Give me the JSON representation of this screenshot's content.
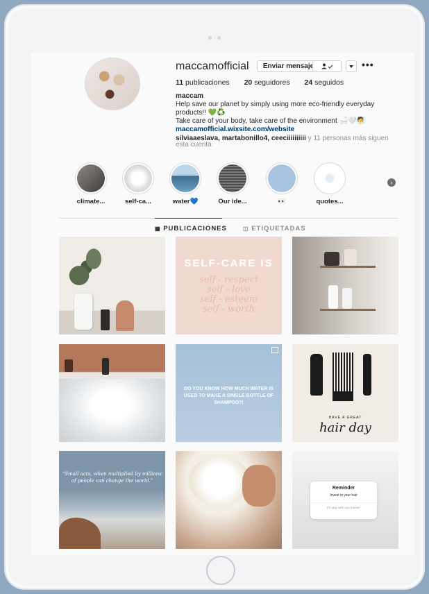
{
  "profile": {
    "username": "maccamofficial",
    "message_button": "Enviar mensaje",
    "follow_icon": "person-check-icon",
    "dropdown_icon": "chevron-down-icon",
    "more_icon": "ellipsis-icon",
    "more_label": "•••"
  },
  "stats": {
    "posts_count": "11",
    "posts_label": "publicaciones",
    "followers_count": "20",
    "followers_label": "seguidores",
    "following_count": "24",
    "following_label": "seguidos"
  },
  "bio": {
    "name": "maccam",
    "line1": "Help save our planet by simply using more eco-friendly everyday products!! 💚♻️",
    "line2": "Take care of your body, take care of the environment 🛁🤍🧖",
    "link": "maccamofficial.wixsite.com/website"
  },
  "followed_by": {
    "names": "silviaaeslava, martabonillo4, ceeciiiiiiiiii",
    "rest": " y 11 personas más siguen esta cuenta"
  },
  "highlights": [
    {
      "label": "climate...",
      "color": "#6f6a64"
    },
    {
      "label": "self-ca...",
      "color": "#e7e7e7"
    },
    {
      "label": "water💙",
      "color": "#4e86a8"
    },
    {
      "label": "Our ide...",
      "color": "#555555"
    },
    {
      "label": "👀",
      "color": "#a9c4de"
    },
    {
      "label": "quotes...",
      "color": "#ffffff"
    }
  ],
  "tabs": {
    "posts": "PUBLICACIONES",
    "posts_icon": "grid-icon",
    "tagged": "ETIQUETADAS",
    "tagged_icon": "tag-icon"
  },
  "posts": [
    {
      "caption": "",
      "bg": "#e9e5df"
    },
    {
      "caption": "SELF-CARE IS\nself - respect\nself - love\nself - esteem\nself - worth",
      "bg": "#f2d9cf"
    },
    {
      "caption": "",
      "bg": "#cfc9c4"
    },
    {
      "caption": "",
      "bg": "#d8cfc8"
    },
    {
      "caption": "DO YOU KNOW HOW MUCH WATER IS USED TO MAKE A SINGLE BOTTLE OF SHAMPOO?!",
      "bg": "#a9c2dc"
    },
    {
      "caption": "HAVE A GREAT\nhair day",
      "bg": "#f1ece6"
    },
    {
      "caption": "\"Small acts, when multiplied by millions of people can change the world.\"",
      "bg": "#7d93a8"
    },
    {
      "caption": "",
      "bg": "#c9a88f"
    },
    {
      "caption": "Reminder\nInvest in your hair\nI'll stay with you forever",
      "bg": "#e8e8e8"
    }
  ]
}
